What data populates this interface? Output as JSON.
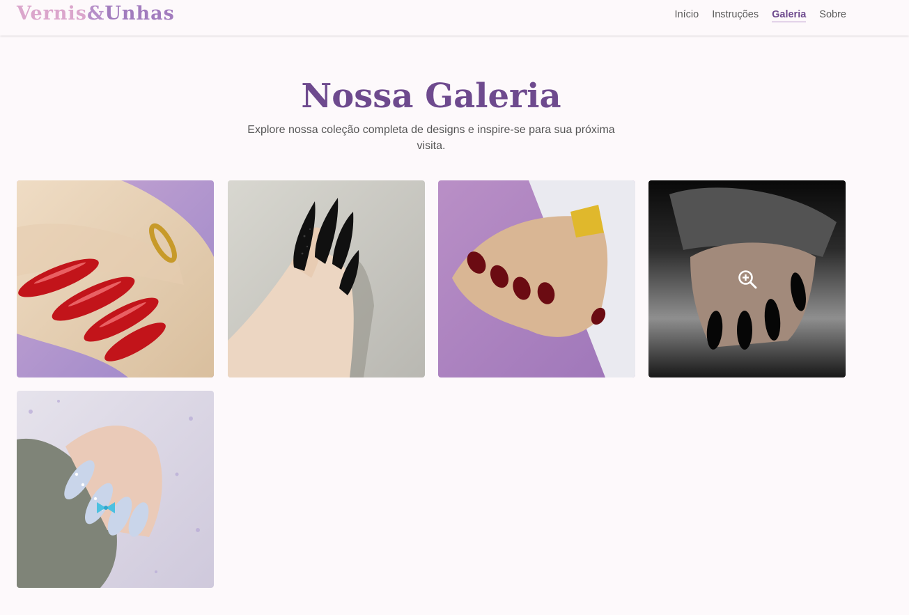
{
  "brand": {
    "part1": "Vernis",
    "part2": "&",
    "part3": "Unhas"
  },
  "nav": {
    "items": [
      "Início",
      "Instruções",
      "Galeria",
      "Sobre"
    ],
    "active": "Galeria"
  },
  "page": {
    "title": "Nossa Galeria",
    "subtitle": "Explore nossa coleção completa de designs e inspire-se para sua próxima visita."
  },
  "colors": {
    "background": "#fdf9fb",
    "brand_primary": "#6e4a8e",
    "brand_pink": "#dba6cc",
    "brand_lilac": "#b68fc8"
  },
  "gallery": {
    "icons": {
      "zoom": "zoom-in-icon"
    },
    "items": [
      {
        "description": "Hand with long glossy red nails and gold twisted ring on purple background"
      },
      {
        "description": "Hand with long black stiletto nails, one glitter black, on grey background"
      },
      {
        "description": "Hand with short dark red nails and gold watch on lilac and white background"
      },
      {
        "description": "Hand with long black nails, one glitter black, with grey sweater sleeve",
        "hovered": true
      },
      {
        "description": "Hand with light blue almond nails with white dots and blue bow, grey knit sweater"
      }
    ]
  }
}
